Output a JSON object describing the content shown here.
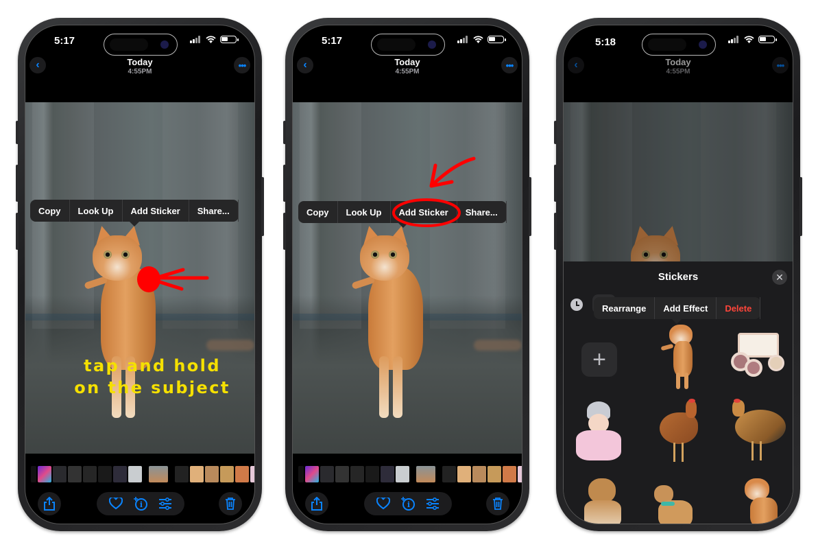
{
  "phones": [
    {
      "status": {
        "time": "5:17"
      },
      "nav": {
        "title": "Today",
        "subtitle": "4:55PM",
        "back_icon": "chevron-left-icon",
        "more_icon": "ellipsis-icon"
      },
      "context_menu": {
        "items": [
          "Copy",
          "Look Up",
          "Add Sticker",
          "Share..."
        ]
      },
      "annotation": {
        "lines": [
          "tap and hold",
          "on the subject"
        ],
        "color": "#f5e000",
        "marker_color": "#ff0000"
      },
      "toolbar": {
        "share_icon": "share-icon",
        "favorite_icon": "heart-icon",
        "info_icon": "info-sparkle-icon",
        "edit_icon": "sliders-icon",
        "delete_icon": "trash-icon"
      }
    },
    {
      "status": {
        "time": "5:17"
      },
      "nav": {
        "title": "Today",
        "subtitle": "4:55PM"
      },
      "context_menu": {
        "items": [
          "Copy",
          "Look Up",
          "Add Sticker",
          "Share..."
        ],
        "highlighted": "Add Sticker"
      },
      "annotation": {
        "marker_color": "#ff0000"
      }
    },
    {
      "status": {
        "time": "5:18"
      },
      "nav": {
        "title": "Today",
        "subtitle": "4:55PM"
      },
      "stickers_sheet": {
        "title": "Stickers",
        "close_icon": "close-icon",
        "recents_icon": "clock-icon",
        "add_label": "+",
        "context_menu": {
          "items": [
            "Rearrange",
            "Add Effect",
            "Delete"
          ],
          "destructive": "Delete",
          "destructive_color": "#ff453a"
        },
        "stickers": [
          "cat",
          "toy wheelchair",
          "baby doll",
          "rooster",
          "hen",
          "dog",
          "dog with harness",
          "cat"
        ]
      }
    }
  ],
  "colors": {
    "accent": "#0a84ff",
    "background": "#000000",
    "menu_bg": "#262627"
  }
}
